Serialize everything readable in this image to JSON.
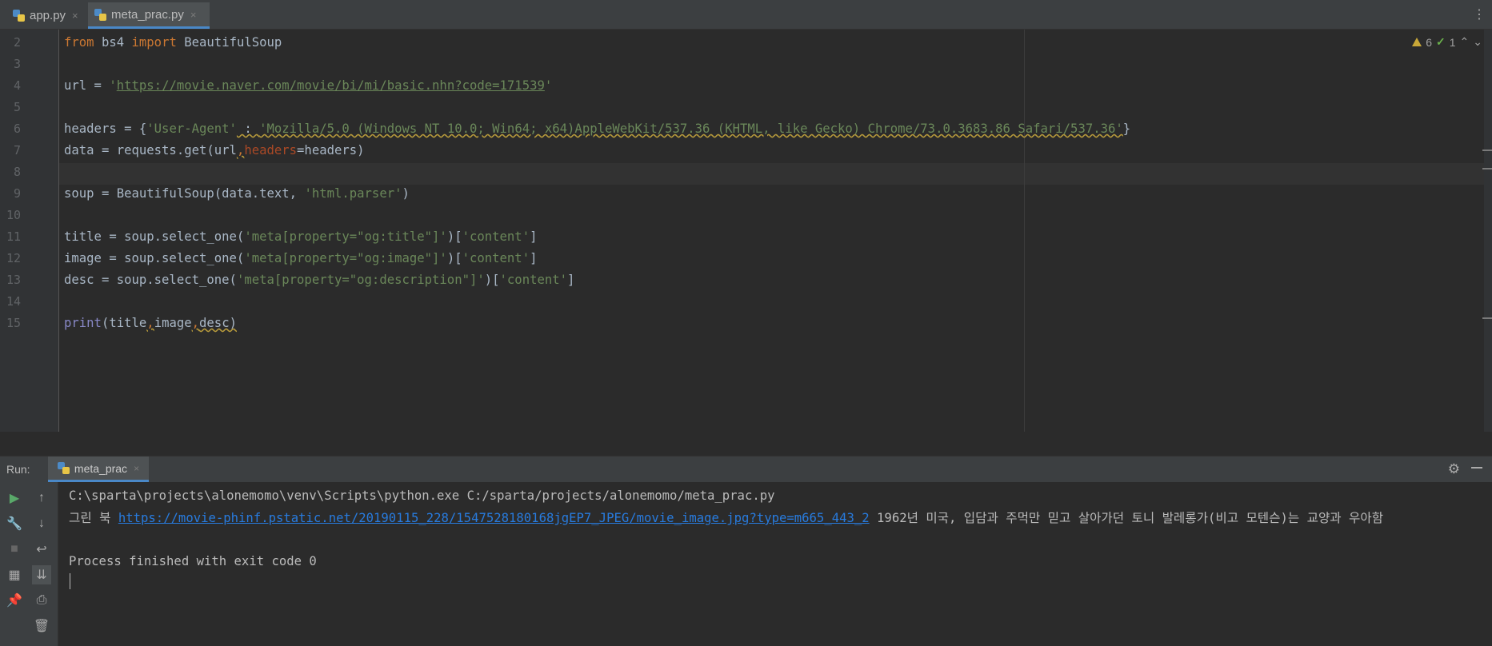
{
  "tabs": [
    {
      "label": "app.py",
      "close": "×"
    },
    {
      "label": "meta_prac.py",
      "close": "×"
    }
  ],
  "editor": {
    "line_numbers": [
      "2",
      "3",
      "4",
      "5",
      "6",
      "7",
      "8",
      "9",
      "10",
      "11",
      "12",
      "13",
      "14",
      "15"
    ],
    "inspections": {
      "warnings": "6",
      "typos": "1"
    },
    "code": {
      "l2_kw1": "from",
      "l2_mod": " bs4 ",
      "l2_kw2": "import",
      "l2_name": " BeautifulSoup",
      "l4_a": "url = ",
      "l4_q1": "'",
      "l4_url": "https://movie.naver.com/movie/bi/mi/basic.nhn?code=171539",
      "l4_q2": "'",
      "l6_a": "headers = {",
      "l6_key": "'User-Agent'",
      "l6_b": " : ",
      "l6_val": "'Mozilla/5.0 (Windows NT 10.0; Win64; x64)AppleWebKit/537.36 (KHTML, like Gecko) Chrome/73.0.3683.86 Safari/537.36'",
      "l6_c": "}",
      "l7_a": "data = requests.get(url",
      "l7_comma": ",",
      "l7_param": "headers",
      "l7_b": "=headers)",
      "l9_a": "soup = BeautifulSoup(data.text, ",
      "l9_str": "'html.parser'",
      "l9_b": ")",
      "l11_a": "title = soup.select_one(",
      "l11_s1": "'meta[property=\"og:title\"]'",
      "l11_b": ")[",
      "l11_s2": "'content'",
      "l11_c": "]",
      "l12_a": "image = soup.select_one(",
      "l12_s1": "'meta[property=\"og:image\"]'",
      "l12_b": ")[",
      "l12_s2": "'content'",
      "l12_c": "]",
      "l13_a": "desc = soup.select_one(",
      "l13_s1": "'meta[property=\"og:description\"]'",
      "l13_b": ")[",
      "l13_s2": "'content'",
      "l13_c": "]",
      "l15_fn": "print",
      "l15_a": "(title",
      "l15_c1": ",",
      "l15_b": "image",
      "l15_c2": ",",
      "l15_d": "desc)"
    }
  },
  "run": {
    "label": "Run:",
    "tab_label": "meta_prac",
    "tab_close": "×",
    "console": {
      "cmd": "C:\\sparta\\projects\\alonemomo\\venv\\Scripts\\python.exe C:/sparta/projects/alonemomo/meta_prac.py",
      "out_title": "그린 북 ",
      "out_link": "https://movie-phinf.pstatic.net/20190115_228/1547528180168jgEP7_JPEG/movie_image.jpg?type=m665_443_2",
      "out_desc": " 1962년 미국, 입담과 주먹만 믿고 살아가던 토니 발레롱가(비고 모텐슨)는 교양과 우아함",
      "exit": "Process finished with exit code 0"
    }
  },
  "colors": {
    "keyword": "#cc7832",
    "string": "#6a8759",
    "param": "#aa4926",
    "builtin": "#8888c6",
    "link": "#287bde",
    "accent": "#4a88c7"
  }
}
